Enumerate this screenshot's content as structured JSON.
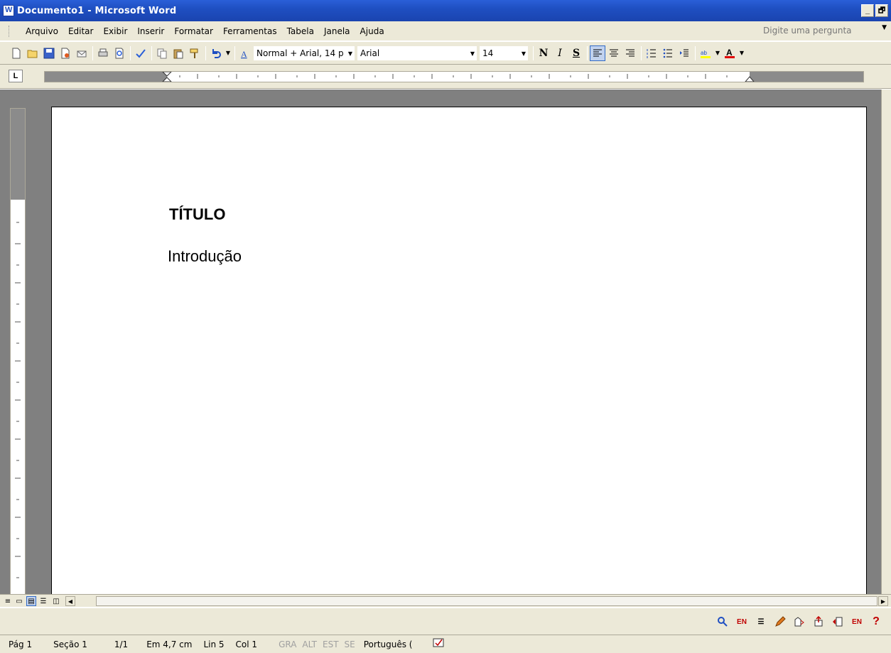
{
  "window": {
    "title": "Documento1 - Microsoft Word",
    "buttons": [
      "_",
      "🗗"
    ]
  },
  "menu": {
    "items": [
      "Arquivo",
      "Editar",
      "Exibir",
      "Inserir",
      "Formatar",
      "Ferramentas",
      "Tabela",
      "Janela",
      "Ajuda"
    ],
    "help_placeholder": "Digite uma pergunta"
  },
  "toolbar": {
    "style": "Normal + Arial, 14 p",
    "font": "Arial",
    "size": "14",
    "bold": "N",
    "italic": "I",
    "underline": "S"
  },
  "document": {
    "title": "TÍTULO",
    "body": "Introdução"
  },
  "status": {
    "page": "Pág 1",
    "section": "Seção 1",
    "pages": "1/1",
    "at": "Em 4,7 cm",
    "line": "Lin 5",
    "col": "Col 1",
    "gra": "GRA",
    "alt": "ALT",
    "est": "EST",
    "se": "SE",
    "language": "Português ("
  },
  "colors": {
    "titlebar": "#1f4fc2",
    "chrome": "#ece9d8",
    "workspace": "#808080"
  }
}
